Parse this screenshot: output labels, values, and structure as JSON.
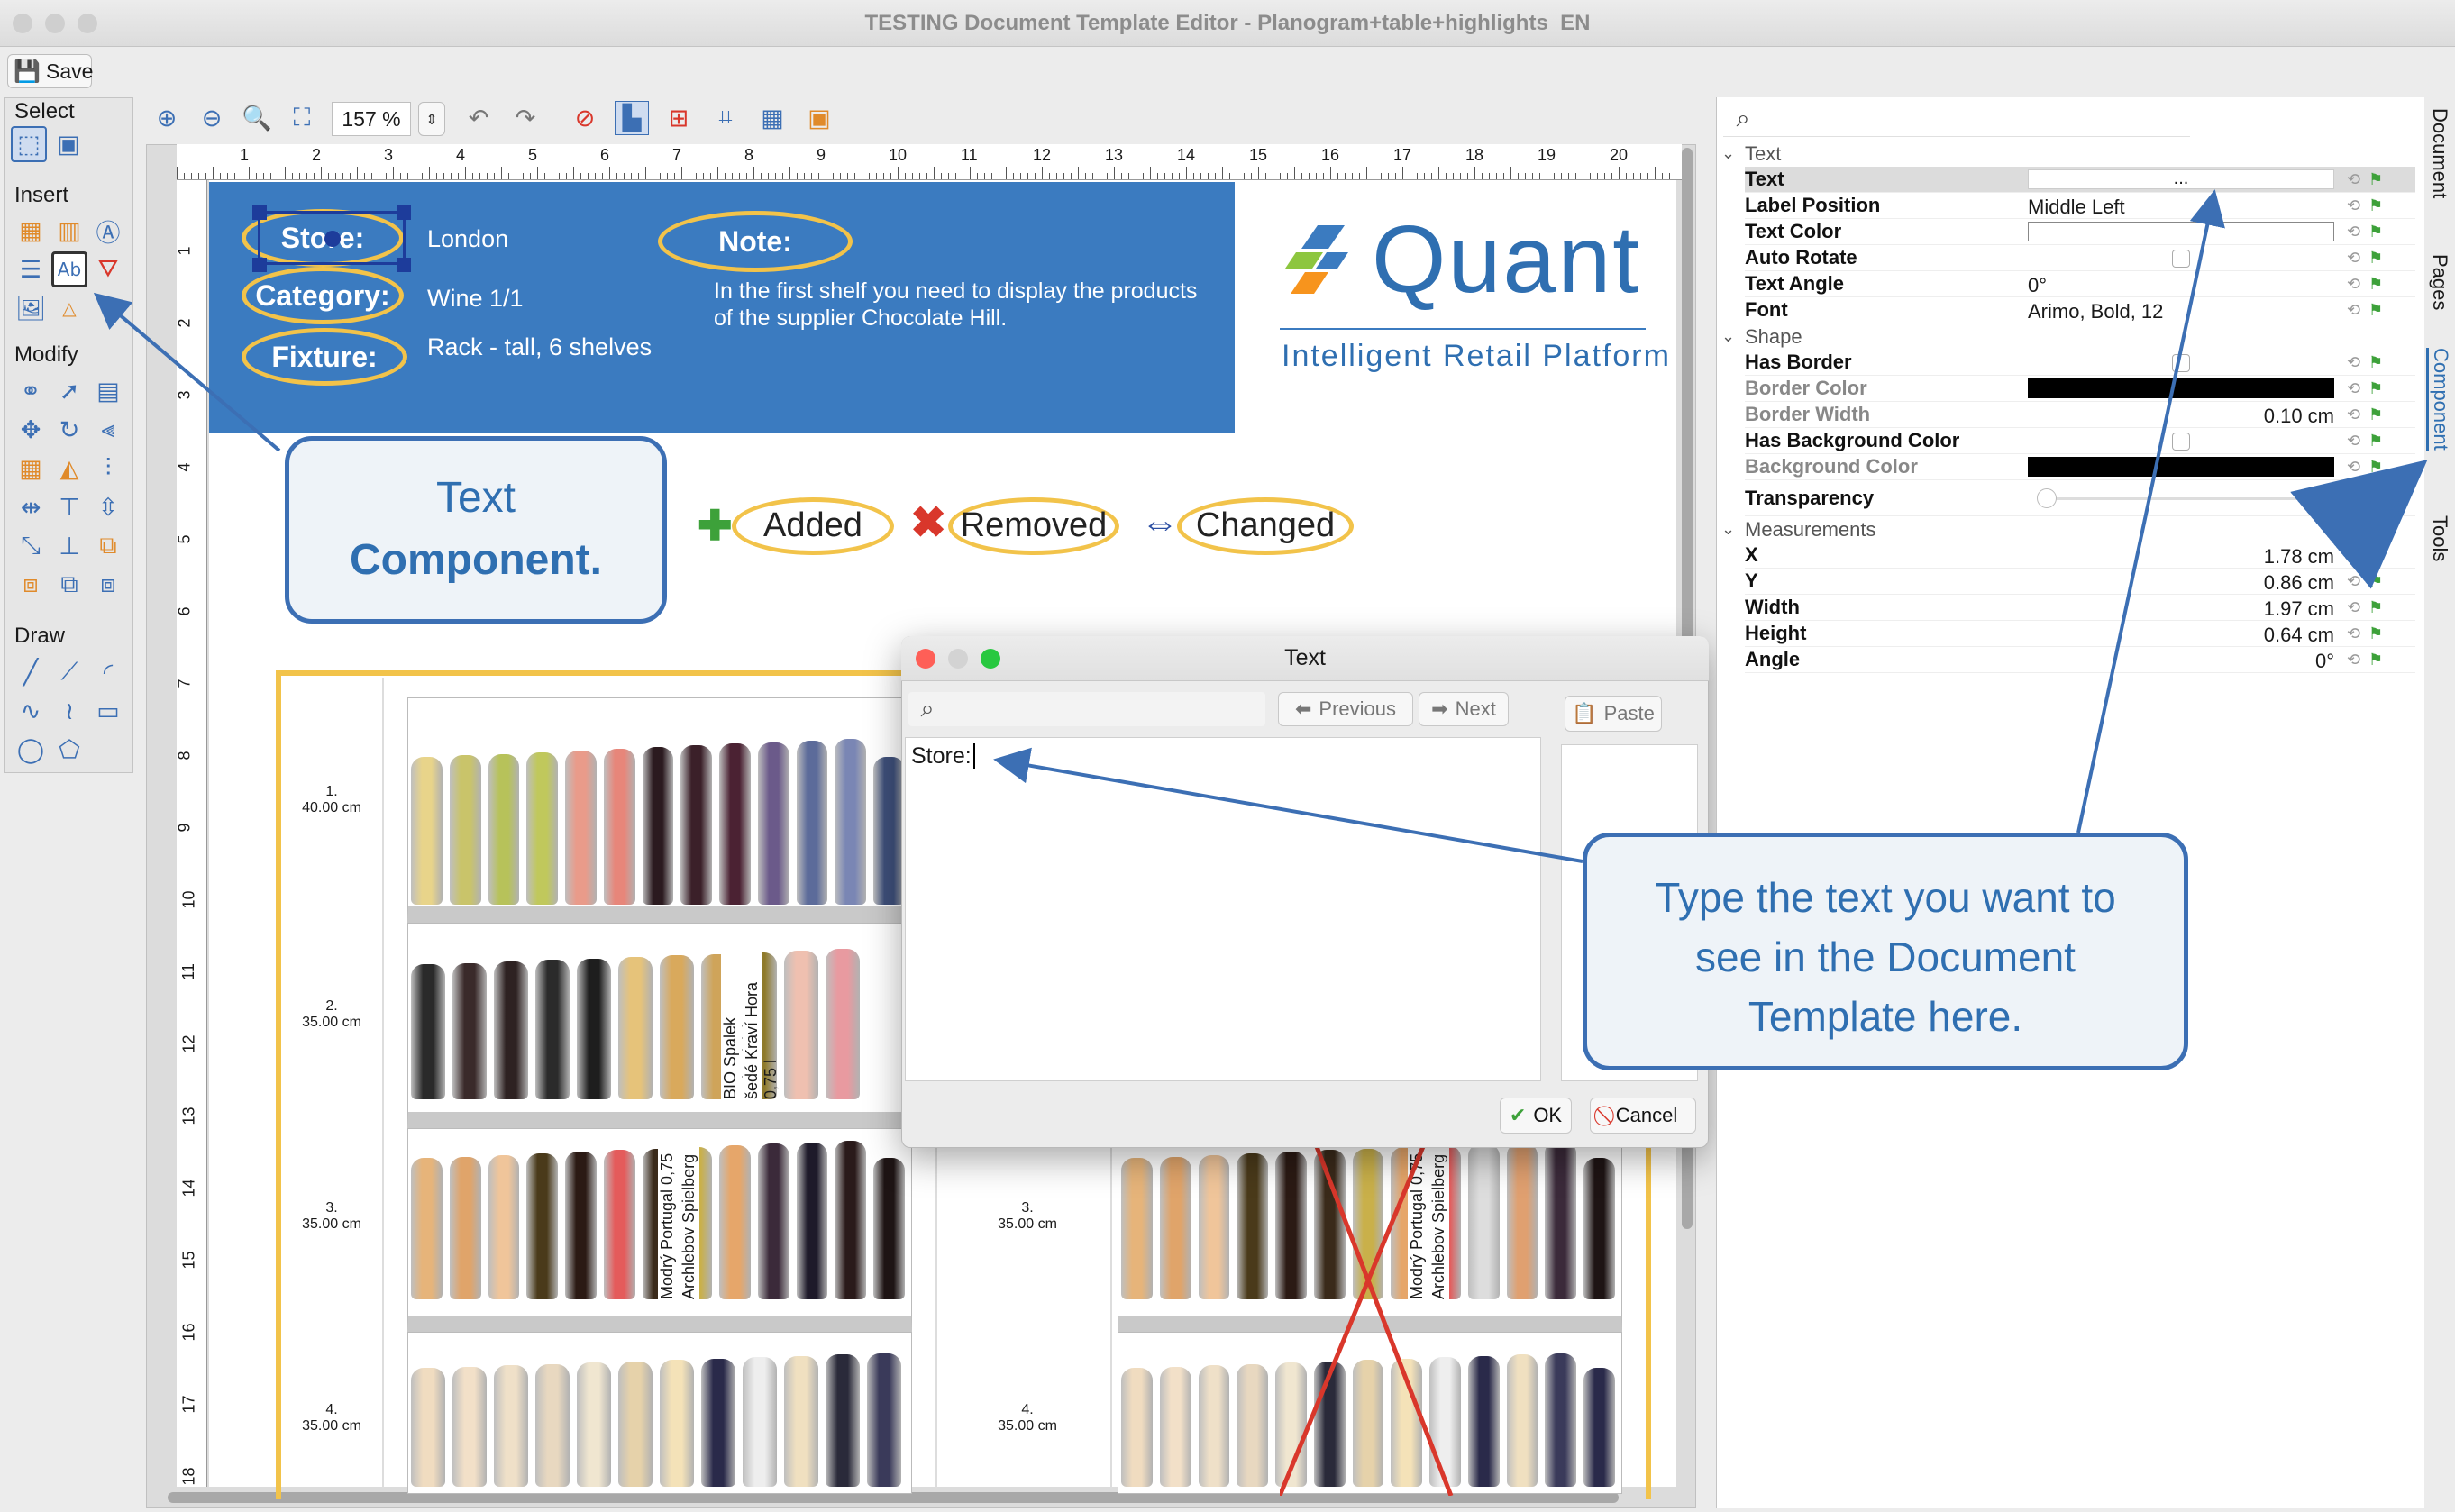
{
  "window": {
    "title": "TESTING Document Template Editor - Planogram+table+highlights_EN"
  },
  "toolbar": {
    "save_label": "Save",
    "zoom": "157 %"
  },
  "palette": {
    "select": "Select",
    "insert": "Insert",
    "modify": "Modify",
    "draw": "Draw"
  },
  "ruler": {
    "h": [
      "1",
      "2",
      "3",
      "4",
      "5",
      "6",
      "7",
      "8",
      "9",
      "10",
      "11",
      "12",
      "13",
      "14",
      "15",
      "16",
      "17",
      "18",
      "19",
      "20"
    ],
    "v": [
      "1",
      "2",
      "3",
      "4",
      "5",
      "6",
      "7",
      "8",
      "9",
      "10",
      "11",
      "12",
      "13",
      "14",
      "15",
      "16",
      "17",
      "18"
    ]
  },
  "header": {
    "store_label": "Store:",
    "store_value": "London",
    "category_label": "Category:",
    "category_value": "Wine 1/1",
    "fixture_label": "Fixture:",
    "fixture_value": "Rack - tall, 6 shelves",
    "note_label": "Note:",
    "note_text": "In the first shelf you need to display the products of the supplier Chocolate Hill."
  },
  "logo": {
    "name": "Quant",
    "tagline": "Intelligent Retail Platform"
  },
  "callout_text": {
    "line1": "Text",
    "line2": "Component."
  },
  "legend": {
    "added": "Added",
    "removed": "Removed",
    "changed": "Changed"
  },
  "shelves": [
    {
      "num": "1.",
      "height": "40.00 cm"
    },
    {
      "num": "2.",
      "height": "35.00 cm"
    },
    {
      "num": "3.",
      "height": "35.00 cm"
    },
    {
      "num": "4.",
      "height": "35.00 cm"
    }
  ],
  "shelves_right": [
    {
      "num": "3.",
      "height": "35.00 cm"
    },
    {
      "num": "4.",
      "height": "35.00 cm"
    }
  ],
  "bottle_labels": {
    "s2a": "BIO Spalek Rulandské",
    "s2b": "šedé Kraví Hora 0,75 l",
    "s3a": "Modrý Portugal 0,75",
    "s3b": "Archlebov Spielberg"
  },
  "dialog": {
    "title": "Text",
    "previous": "Previous",
    "next": "Next",
    "paste": "Paste",
    "content": "Store:",
    "ok": "OK",
    "cancel": "Cancel"
  },
  "callout_type": {
    "line1": "Type the text you want to",
    "line2": "see in the Document",
    "line3": "Template here."
  },
  "properties": {
    "sections": {
      "text": "Text",
      "shape": "Shape",
      "measurements": "Measurements"
    },
    "rows": [
      {
        "label": "Text",
        "value": "..."
      },
      {
        "label": "Label Position",
        "value": "Middle Left"
      },
      {
        "label": "Text Color",
        "value": ""
      },
      {
        "label": "Auto Rotate",
        "value": ""
      },
      {
        "label": "Text Angle",
        "value": "0°"
      },
      {
        "label": "Font",
        "value": "Arimo, Bold, 12"
      },
      {
        "label": "Has Border",
        "value": ""
      },
      {
        "label": "Border Color",
        "value": ""
      },
      {
        "label": "Border Width",
        "value": "0.10 cm"
      },
      {
        "label": "Has Background Color",
        "value": ""
      },
      {
        "label": "Background Color",
        "value": ""
      },
      {
        "label": "Transparency",
        "value": ""
      },
      {
        "label": "X",
        "value": "1.78 cm"
      },
      {
        "label": "Y",
        "value": "0.86 cm"
      },
      {
        "label": "Width",
        "value": "1.97 cm"
      },
      {
        "label": "Height",
        "value": "0.64 cm"
      },
      {
        "label": "Angle",
        "value": "0°"
      }
    ]
  },
  "side_tabs": {
    "document": "Document",
    "pages": "Pages",
    "component": "Component",
    "tools": "Tools"
  }
}
